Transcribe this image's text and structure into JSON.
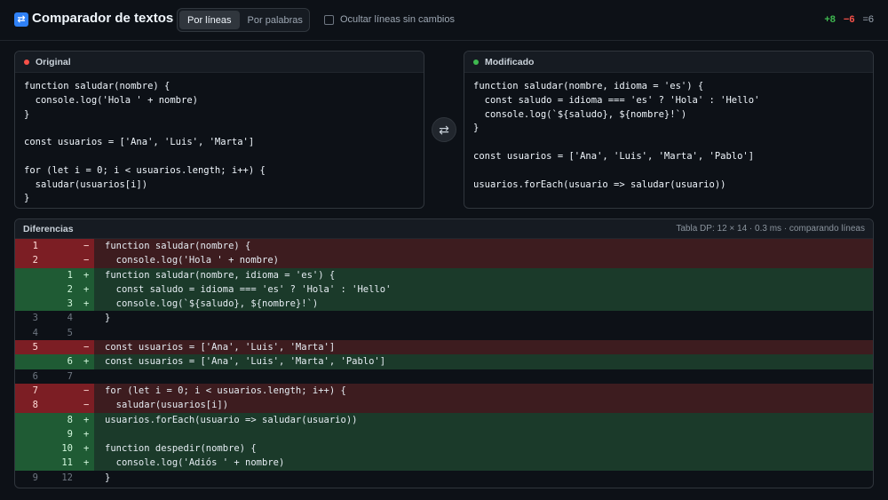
{
  "header": {
    "logo_glyph": "⇄",
    "title": "Comparador de textos",
    "modes": [
      "Por líneas",
      "Por palabras"
    ],
    "active_mode": "Por líneas",
    "hide_unchanged_label": "Ocultar líneas sin cambios",
    "stats": {
      "added": "+8",
      "removed": "−6",
      "equal": "=6"
    }
  },
  "colors": {
    "added": "#3fb950",
    "removed": "#f85149",
    "accent": "#2f81f7"
  },
  "original": {
    "label": "Original",
    "lines": [
      "function saludar(nombre) {",
      "  console.log('Hola ' + nombre)",
      "}",
      "",
      "const usuarios = ['Ana', 'Luis', 'Marta']",
      "",
      "for (let i = 0; i < usuarios.length; i++) {",
      "  saludar(usuarios[i])",
      "}"
    ]
  },
  "modified": {
    "label": "Modificado",
    "lines": [
      "function saludar(nombre, idioma = 'es') {",
      "  const saludo = idioma === 'es' ? 'Hola' : 'Hello'",
      "  console.log(`${saludo}, ${nombre}!`)",
      "}",
      "",
      "const usuarios = ['Ana', 'Luis', 'Marta', 'Pablo']",
      "",
      "usuarios.forEach(usuario => saludar(usuario))"
    ]
  },
  "swap_icon": "⇄",
  "diff": {
    "title": "Diferencias",
    "meta": "Tabla DP: 12 × 14 · 0.3 ms · comparando líneas",
    "rows": [
      {
        "type": "del",
        "old": "1",
        "new": "",
        "sign": "−",
        "text": "function saludar(nombre) {"
      },
      {
        "type": "del",
        "old": "2",
        "new": "",
        "sign": "−",
        "text": "  console.log('Hola ' + nombre)"
      },
      {
        "type": "add",
        "old": "",
        "new": "1",
        "sign": "+",
        "text": "function saludar(nombre, idioma = 'es') {"
      },
      {
        "type": "add",
        "old": "",
        "new": "2",
        "sign": "+",
        "text": "  const saludo = idioma === 'es' ? 'Hola' : 'Hello'"
      },
      {
        "type": "add",
        "old": "",
        "new": "3",
        "sign": "+",
        "text": "  console.log(`${saludo}, ${nombre}!`)"
      },
      {
        "type": "eq",
        "old": "3",
        "new": "4",
        "sign": "",
        "text": "}"
      },
      {
        "type": "eq",
        "old": "4",
        "new": "5",
        "sign": "",
        "text": ""
      },
      {
        "type": "del",
        "old": "5",
        "new": "",
        "sign": "−",
        "text": "const usuarios = ['Ana', 'Luis', 'Marta']"
      },
      {
        "type": "add",
        "old": "",
        "new": "6",
        "sign": "+",
        "text": "const usuarios = ['Ana', 'Luis', 'Marta', 'Pablo']"
      },
      {
        "type": "eq",
        "old": "6",
        "new": "7",
        "sign": "",
        "text": ""
      },
      {
        "type": "del",
        "old": "7",
        "new": "",
        "sign": "−",
        "text": "for (let i = 0; i < usuarios.length; i++) {"
      },
      {
        "type": "del",
        "old": "8",
        "new": "",
        "sign": "−",
        "text": "  saludar(usuarios[i])"
      },
      {
        "type": "add",
        "old": "",
        "new": "8",
        "sign": "+",
        "text": "usuarios.forEach(usuario => saludar(usuario))"
      },
      {
        "type": "add",
        "old": "",
        "new": "9",
        "sign": "+",
        "text": ""
      },
      {
        "type": "add",
        "old": "",
        "new": "10",
        "sign": "+",
        "text": "function despedir(nombre) {"
      },
      {
        "type": "add",
        "old": "",
        "new": "11",
        "sign": "+",
        "text": "  console.log('Adiós ' + nombre)"
      },
      {
        "type": "eq",
        "old": "9",
        "new": "12",
        "sign": "",
        "text": "}"
      }
    ]
  }
}
